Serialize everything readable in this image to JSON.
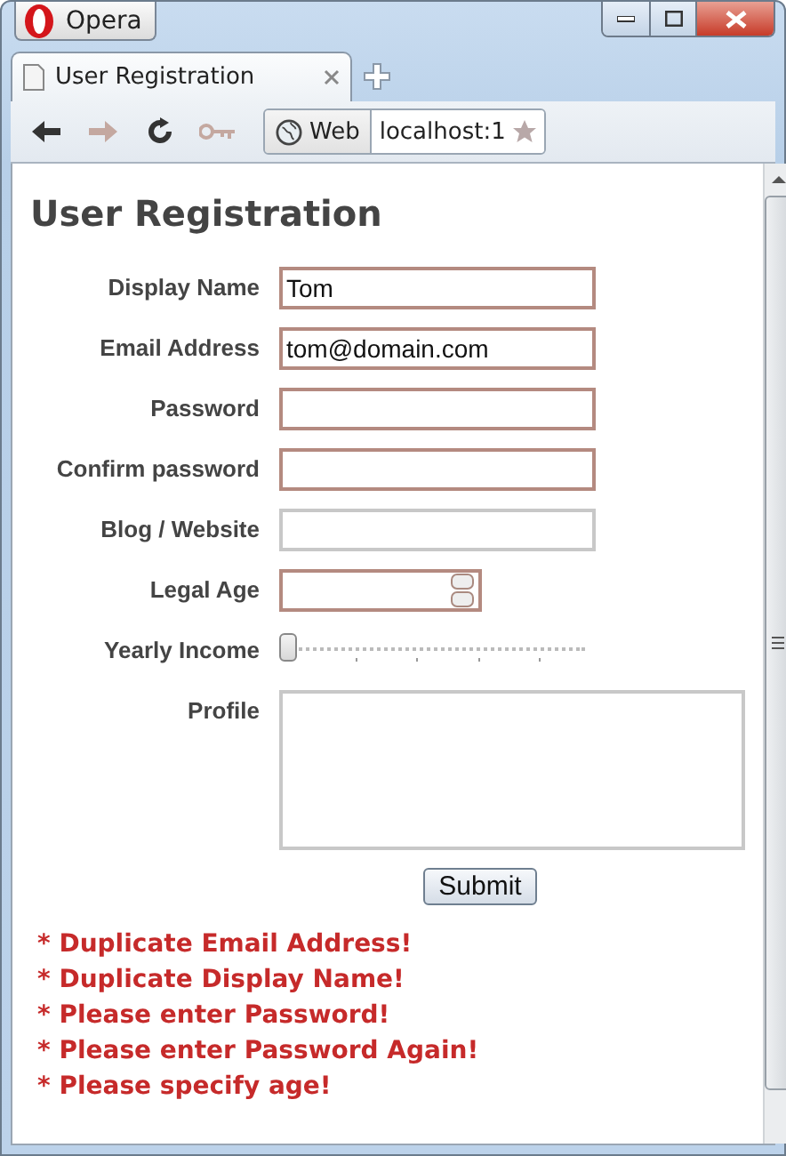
{
  "window": {
    "app_button": "Opera"
  },
  "tabs": [
    {
      "label": "User Registration",
      "selected": true
    }
  ],
  "toolbar": [
    {
      "kind": "back",
      "disabled": false
    },
    {
      "kind": "forward",
      "disabled": true
    },
    {
      "kind": "reload",
      "disabled": false
    },
    {
      "kind": "key",
      "disabled": true
    }
  ],
  "address_bar": {
    "search_label": "Web",
    "url": "localhost:1"
  },
  "page": {
    "title": "User Registration",
    "fields": [
      {
        "label": "Display Name",
        "kind": "text",
        "value": "Tom",
        "invalid": true
      },
      {
        "label": "Email Address",
        "kind": "text",
        "value": "tom@domain.com",
        "invalid": true
      },
      {
        "label": "Password",
        "kind": "text",
        "invalid": true
      },
      {
        "label": "Confirm password",
        "kind": "text",
        "invalid": true
      },
      {
        "label": "Blog / Website",
        "kind": "text",
        "invalid": false
      },
      {
        "label": "Legal Age",
        "kind": "number",
        "invalid": true
      },
      {
        "label": "Yearly Income",
        "kind": "range",
        "level": 0
      },
      {
        "label": "Profile",
        "kind": "textarea",
        "invalid": false
      }
    ],
    "submit": "Submit",
    "errors": [
      "* Duplicate Email Address!",
      "* Duplicate Display Name!",
      "* Please enter Password!",
      "* Please enter Password Again!",
      "* Please specify age!"
    ]
  }
}
